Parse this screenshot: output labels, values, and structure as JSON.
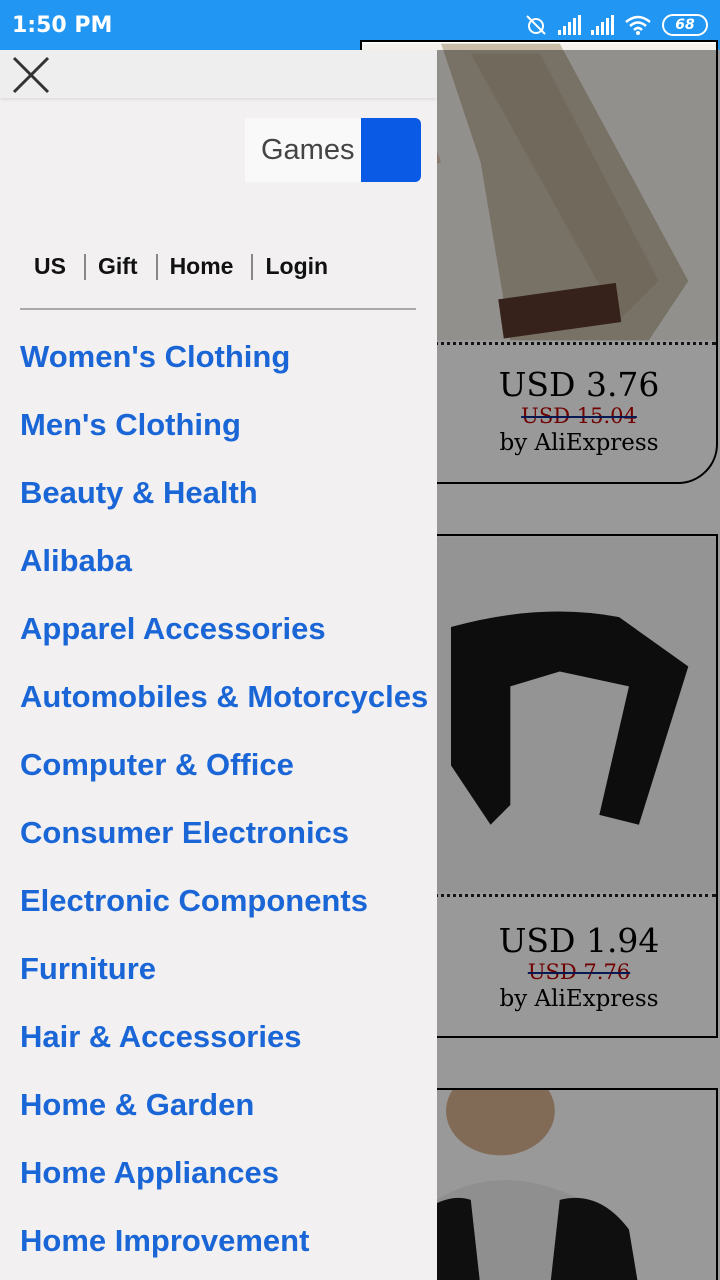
{
  "status_bar": {
    "time": "1:50 PM",
    "battery": "68"
  },
  "search": {
    "value": "Games"
  },
  "top_links": [
    "US",
    "Gift",
    "Home",
    "Login"
  ],
  "categories": [
    "Women's Clothing",
    "Men's Clothing",
    "Beauty & Health",
    "Alibaba",
    "Apparel Accessories",
    "Automobiles & Motorcycles",
    "Computer & Office",
    "Consumer Electronics",
    "Electronic Components",
    "Furniture",
    "Hair & Accessories",
    "Home & Garden",
    "Home Appliances",
    "Home Improvement"
  ],
  "products": [
    {
      "price": "USD 3.76",
      "original_price": "USD 15.04",
      "seller": "by AliExpress"
    },
    {
      "price": "USD 1.94",
      "original_price": "USD 7.76",
      "seller": "by AliExpress"
    }
  ],
  "colors": {
    "status_bar": "#2196f3",
    "link": "#1a66d6",
    "search_button": "#0b5ae6"
  },
  "icons": {
    "close": "close-icon",
    "search_button": "search-button"
  }
}
